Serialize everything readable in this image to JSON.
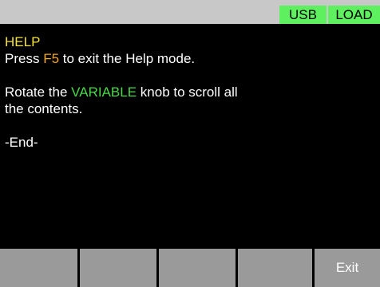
{
  "status_bar": {
    "usb": "USB",
    "load": "LOAD"
  },
  "help": {
    "title": "HELP",
    "line1_pre": "Press ",
    "line1_key": "F5",
    "line1_post": " to exit the Help mode.",
    "line2_pre": "Rotate the ",
    "line2_knob": "VARIABLE",
    "line2_post": " knob to scroll all",
    "line3": "the contents.",
    "end": "-End-"
  },
  "softkeys": {
    "f1": "",
    "f2": "",
    "f3": "",
    "f4": "",
    "f5": "Exit"
  },
  "colors": {
    "status_tag": "#5ff05f",
    "highlight_yellow": "#f5e23a",
    "highlight_orange": "#f5a623",
    "highlight_green": "#4ad84a"
  }
}
